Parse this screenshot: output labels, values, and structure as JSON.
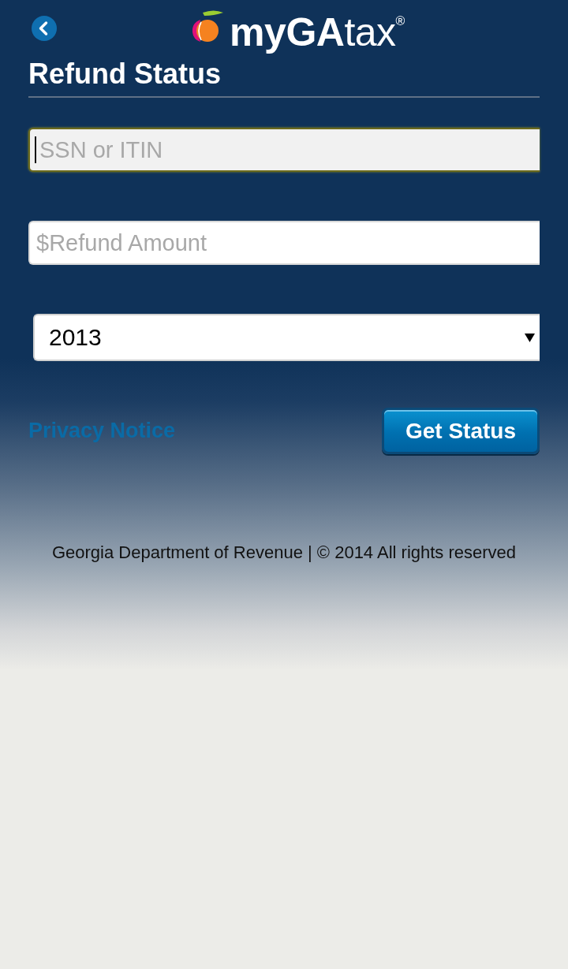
{
  "header": {
    "logo": "**myGA**tax$^{®}$"
  },
  "title": "Refund Status",
  "fields": [
    {
      "placeholder": "SSN or ITIN",
      "focused": true
    },
    {
      "placeholder": "$Refund Amount",
      "focused": false
    }
  ],
  "year_select": {
    "value": "2013"
  },
  "privacy_link": "Privacy Notice",
  "submit_button": "Get Status",
  "footer": "Georgia Department of Revenue | © 2014 All rights reserved"
}
